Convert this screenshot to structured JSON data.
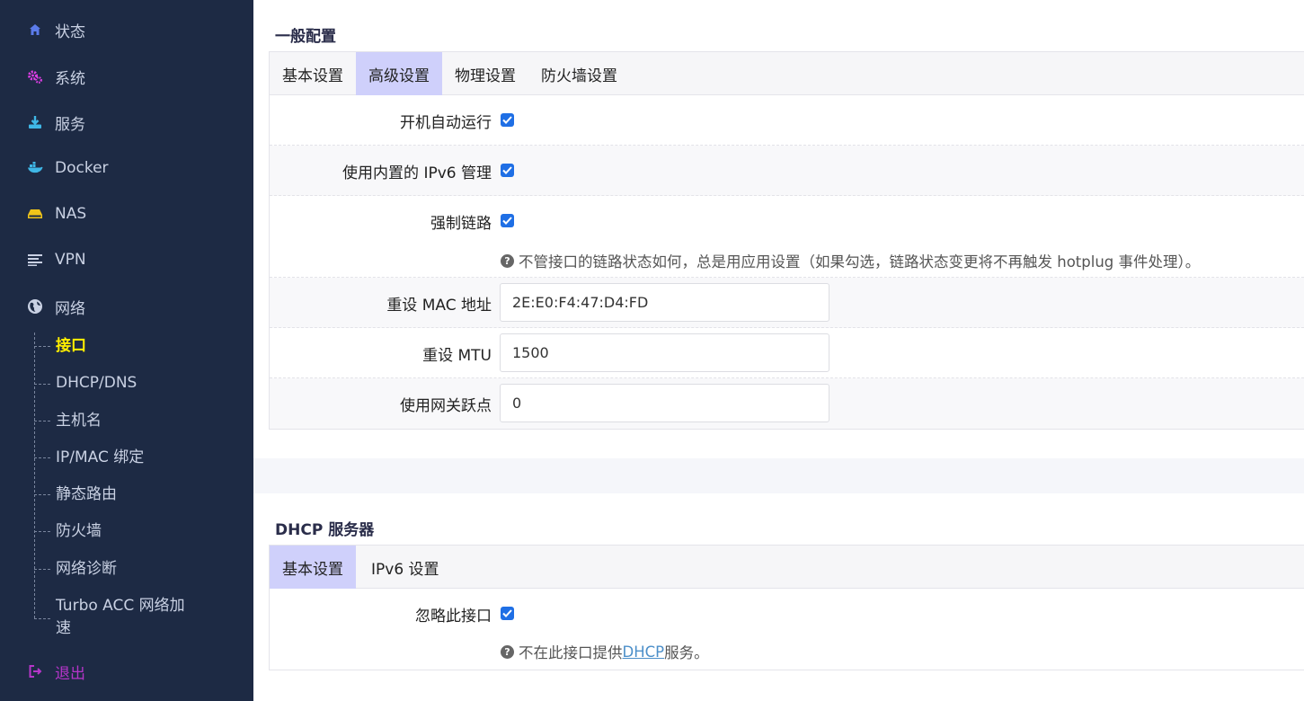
{
  "sidebar": {
    "items": [
      {
        "label": "状态",
        "icon": "home-icon"
      },
      {
        "label": "系统",
        "icon": "gears-icon"
      },
      {
        "label": "服务",
        "icon": "download-icon"
      },
      {
        "label": "Docker",
        "icon": "docker-icon"
      },
      {
        "label": "NAS",
        "icon": "drive-icon"
      },
      {
        "label": "VPN",
        "icon": "list-icon"
      },
      {
        "label": "网络",
        "icon": "globe-icon"
      }
    ],
    "network_sub": [
      "接口",
      "DHCP/DNS",
      "主机名",
      "IP/MAC 绑定",
      "静态路由",
      "防火墙",
      "网络诊断",
      "Turbo ACC 网络加",
      "速"
    ],
    "logout": "退出",
    "colors": {
      "bg": "#1d2a44",
      "active": "#ffee00",
      "logout": "#b535c9"
    }
  },
  "general": {
    "title": "一般配置",
    "tabs": [
      "基本设置",
      "高级设置",
      "物理设置",
      "防火墙设置"
    ],
    "active_tab": "高级设置",
    "fields": {
      "auto_start_label": "开机自动运行",
      "ipv6_label": "使用内置的 IPv6 管理",
      "force_link_label": "强制链路",
      "force_link_help": "不管接口的链路状态如何，总是用应用设置（如果勾选，链路状态变更将不再触发 hotplug 事件处理）。",
      "mac_label": "重设 MAC 地址",
      "mac_value": "2E:E0:F4:47:D4:FD",
      "mtu_label": "重设 MTU",
      "mtu_value": "1500",
      "metric_label": "使用网关跃点",
      "metric_value": "0"
    }
  },
  "dhcp": {
    "title": "DHCP 服务器",
    "tabs": [
      "基本设置",
      "IPv6 设置"
    ],
    "active_tab": "基本设置",
    "ignore_label": "忽略此接口",
    "help_pre": "不在此接口提供 ",
    "help_link": "DHCP",
    "help_post": " 服务。"
  }
}
